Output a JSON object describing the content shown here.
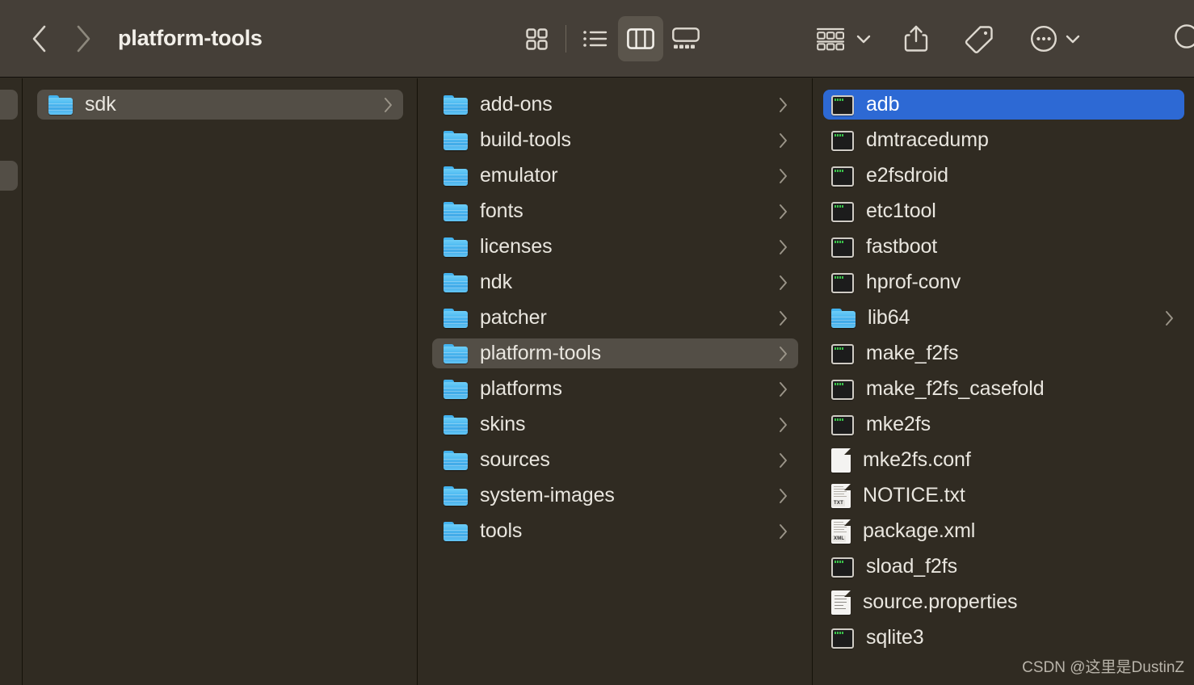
{
  "window": {
    "title": "platform-tools"
  },
  "toolbar": {
    "back_label": "Back",
    "forward_label": "Forward",
    "back_icon": "chevron-left-icon",
    "forward_icon": "chevron-right-icon",
    "view_modes": [
      {
        "id": "icon",
        "label": "Icon View",
        "icon": "grid-icon",
        "active": false
      },
      {
        "id": "list",
        "label": "List View",
        "icon": "list-icon",
        "active": false
      },
      {
        "id": "column",
        "label": "Column View",
        "icon": "columns-icon",
        "active": true
      },
      {
        "id": "gallery",
        "label": "Gallery View",
        "icon": "gallery-icon",
        "active": false
      }
    ],
    "actions": [
      {
        "id": "group",
        "label": "Group Items",
        "icon": "group-by-icon",
        "has_caret": true
      },
      {
        "id": "share",
        "label": "Share",
        "icon": "share-icon",
        "has_caret": false
      },
      {
        "id": "tags",
        "label": "Edit Tags",
        "icon": "tag-icon",
        "has_caret": false
      },
      {
        "id": "more",
        "label": "More",
        "icon": "ellipsis-circle-icon",
        "has_caret": true
      },
      {
        "id": "search",
        "label": "Search",
        "icon": "search-icon",
        "has_caret": false
      }
    ]
  },
  "columns": [
    {
      "id": "col-1",
      "items": [
        {
          "name": "sdk",
          "icon": "folder-icon",
          "kind": "folder",
          "chevron": true,
          "selection": "inactive"
        }
      ]
    },
    {
      "id": "col-2",
      "items": [
        {
          "name": "add-ons",
          "icon": "folder-icon",
          "kind": "folder",
          "chevron": true,
          "selection": "none"
        },
        {
          "name": "build-tools",
          "icon": "folder-icon",
          "kind": "folder",
          "chevron": true,
          "selection": "none"
        },
        {
          "name": "emulator",
          "icon": "folder-icon",
          "kind": "folder",
          "chevron": true,
          "selection": "none"
        },
        {
          "name": "fonts",
          "icon": "folder-icon",
          "kind": "folder",
          "chevron": true,
          "selection": "none"
        },
        {
          "name": "licenses",
          "icon": "folder-icon",
          "kind": "folder",
          "chevron": true,
          "selection": "none"
        },
        {
          "name": "ndk",
          "icon": "folder-icon",
          "kind": "folder",
          "chevron": true,
          "selection": "none"
        },
        {
          "name": "patcher",
          "icon": "folder-icon",
          "kind": "folder",
          "chevron": true,
          "selection": "none"
        },
        {
          "name": "platform-tools",
          "icon": "folder-icon",
          "kind": "folder",
          "chevron": true,
          "selection": "inactive"
        },
        {
          "name": "platforms",
          "icon": "folder-icon",
          "kind": "folder",
          "chevron": true,
          "selection": "none"
        },
        {
          "name": "skins",
          "icon": "folder-icon",
          "kind": "folder",
          "chevron": true,
          "selection": "none"
        },
        {
          "name": "sources",
          "icon": "folder-icon",
          "kind": "folder",
          "chevron": true,
          "selection": "none"
        },
        {
          "name": "system-images",
          "icon": "folder-icon",
          "kind": "folder",
          "chevron": true,
          "selection": "none"
        },
        {
          "name": "tools",
          "icon": "folder-icon",
          "kind": "folder",
          "chevron": true,
          "selection": "none"
        }
      ]
    },
    {
      "id": "col-3",
      "items": [
        {
          "name": "adb",
          "icon": "terminal-icon",
          "kind": "exec",
          "chevron": false,
          "selection": "active"
        },
        {
          "name": "dmtracedump",
          "icon": "terminal-icon",
          "kind": "exec",
          "chevron": false,
          "selection": "none"
        },
        {
          "name": "e2fsdroid",
          "icon": "terminal-icon",
          "kind": "exec",
          "chevron": false,
          "selection": "none"
        },
        {
          "name": "etc1tool",
          "icon": "terminal-icon",
          "kind": "exec",
          "chevron": false,
          "selection": "none"
        },
        {
          "name": "fastboot",
          "icon": "terminal-icon",
          "kind": "exec",
          "chevron": false,
          "selection": "none"
        },
        {
          "name": "hprof-conv",
          "icon": "terminal-icon",
          "kind": "exec",
          "chevron": false,
          "selection": "none"
        },
        {
          "name": "lib64",
          "icon": "folder-icon",
          "kind": "folder",
          "chevron": true,
          "selection": "none"
        },
        {
          "name": "make_f2fs",
          "icon": "terminal-icon",
          "kind": "exec",
          "chevron": false,
          "selection": "none"
        },
        {
          "name": "make_f2fs_casefold",
          "icon": "terminal-icon",
          "kind": "exec",
          "chevron": false,
          "selection": "none"
        },
        {
          "name": "mke2fs",
          "icon": "terminal-icon",
          "kind": "exec",
          "chevron": false,
          "selection": "none"
        },
        {
          "name": "mke2fs.conf",
          "icon": "document-icon",
          "kind": "doc-plain",
          "chevron": false,
          "selection": "none"
        },
        {
          "name": "NOTICE.txt",
          "icon": "text-document-icon",
          "kind": "doc-txt",
          "badge": "TXT",
          "chevron": false,
          "selection": "none"
        },
        {
          "name": "package.xml",
          "icon": "xml-document-icon",
          "kind": "doc-xml",
          "badge": "XML",
          "chevron": false,
          "selection": "none"
        },
        {
          "name": "sload_f2fs",
          "icon": "terminal-icon",
          "kind": "exec",
          "chevron": false,
          "selection": "none"
        },
        {
          "name": "source.properties",
          "icon": "lined-document-icon",
          "kind": "doc-lined",
          "chevron": false,
          "selection": "none"
        },
        {
          "name": "sqlite3",
          "icon": "terminal-icon",
          "kind": "exec",
          "chevron": false,
          "selection": "none"
        }
      ]
    }
  ],
  "watermark": {
    "text": "CSDN @这里是DustinZ"
  },
  "colors": {
    "toolbar_bg": "#453f38",
    "content_bg": "#302b22",
    "selection_active": "#2d69d4",
    "selection_inactive": "#534e46",
    "text": "#e9e6df",
    "folder_blue": "#54bef3"
  }
}
